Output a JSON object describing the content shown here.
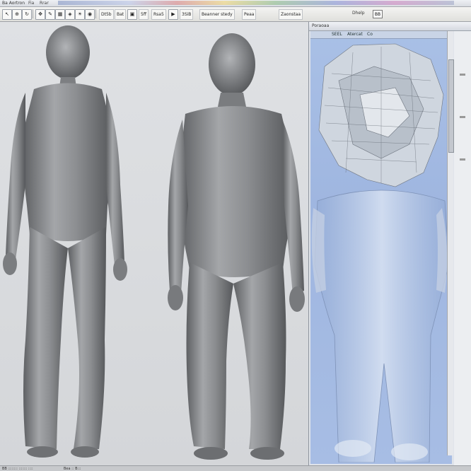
{
  "menubar": {
    "app_title": "Ba Aortron",
    "items": [
      "Fia",
      "Rrar"
    ]
  },
  "toolbar": {
    "labels": [
      "Dt5b",
      "Bat",
      "5ff",
      "Rsa5",
      "3SiB",
      "Beanner stedy",
      "Peaa",
      "Zaonstaa"
    ],
    "zoom_label": "Dhelp",
    "zoom_value": "BB"
  },
  "panel": {
    "header_title": "Poraoaa",
    "tab_labels": [
      "SEEL",
      "Atercat",
      "Co"
    ]
  },
  "bottom_bar": {
    "left_text": "BB :::::::: ::::::: ::::",
    "mid_text": "Bea :: B:::"
  },
  "colors": {
    "viewport_bg": "#d7d9dc",
    "panel_bg": "#a9c0e6",
    "model_gray": "#8a8c8f"
  },
  "icons": [
    "pointer-icon",
    "zoom-icon",
    "rotate-icon",
    "pan-icon",
    "brush-icon",
    "grid-icon",
    "mesh-icon",
    "light-icon",
    "camera-icon",
    "save-icon",
    "render-icon"
  ]
}
